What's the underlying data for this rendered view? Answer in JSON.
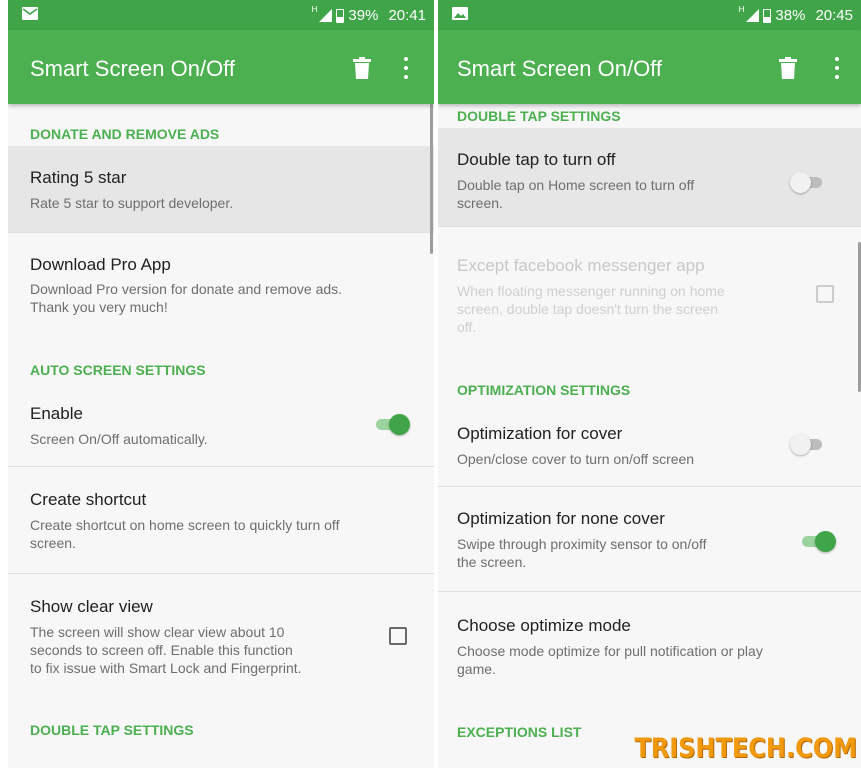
{
  "left": {
    "status": {
      "battery": "39%",
      "time": "20:41",
      "network": "H"
    },
    "appbar": {
      "title": "Smart Screen On/Off"
    },
    "sections": {
      "donate": "DONATE AND REMOVE ADS",
      "auto": "AUTO SCREEN SETTINGS",
      "double_tap": "DOUBLE TAP SETTINGS"
    },
    "items": {
      "rating": {
        "title": "Rating 5 star",
        "summary": "Rate 5 star to support developer."
      },
      "pro": {
        "title": "Download Pro App",
        "summary1": "Download Pro version for donate and remove ads.",
        "summary2": "Thank you very much!"
      },
      "enable": {
        "title": "Enable",
        "summary": "Screen On/Off automatically.",
        "state": "on"
      },
      "shortcut": {
        "title": "Create shortcut",
        "summary1": "Create shortcut on home screen to quickly turn off",
        "summary2": "screen."
      },
      "clear_view": {
        "title": "Show clear view",
        "summary1": "The screen will show clear view about 10",
        "summary2": "seconds to screen off. Enable this function",
        "summary3": "to fix issue with Smart Lock and Fingerprint.",
        "checked": false
      }
    }
  },
  "right": {
    "status": {
      "battery": "38%",
      "time": "20:45",
      "network": "H"
    },
    "appbar": {
      "title": "Smart Screen On/Off"
    },
    "sections": {
      "double_tap": "DOUBLE TAP SETTINGS",
      "optimization": "OPTIMIZATION SETTINGS",
      "exceptions": "EXCEPTIONS LIST"
    },
    "items": {
      "double_tap_off": {
        "title": "Double tap to turn off",
        "summary1": "Double tap on Home screen to turn off",
        "summary2": "screen.",
        "state": "off"
      },
      "except_fb": {
        "title": "Except facebook messenger app",
        "summary1": "When floating messenger running on home",
        "summary2": "screen, double tap doesn't turn the screen",
        "summary3": "off.",
        "checked": false,
        "enabled": false
      },
      "cover": {
        "title": "Optimization for cover",
        "summary": "Open/close cover to turn on/off screen",
        "state": "off"
      },
      "none_cover": {
        "title": "Optimization for none cover",
        "summary1": "Swipe through proximity sensor to on/off",
        "summary2": "the screen.",
        "state": "on"
      },
      "optimize_mode": {
        "title": "Choose optimize mode",
        "summary1": "Choose mode optimize for pull notification or play",
        "summary2": "game."
      }
    }
  },
  "watermark": "TRISHTECH.COM",
  "colors": {
    "appbar": "#4caf50",
    "statusbar": "#3fa548",
    "accent": "#4caf50"
  },
  "icons": [
    "email-notification-icon",
    "image-notification-icon",
    "signal-icon",
    "battery-icon",
    "trash-icon",
    "overflow-menu-icon"
  ]
}
